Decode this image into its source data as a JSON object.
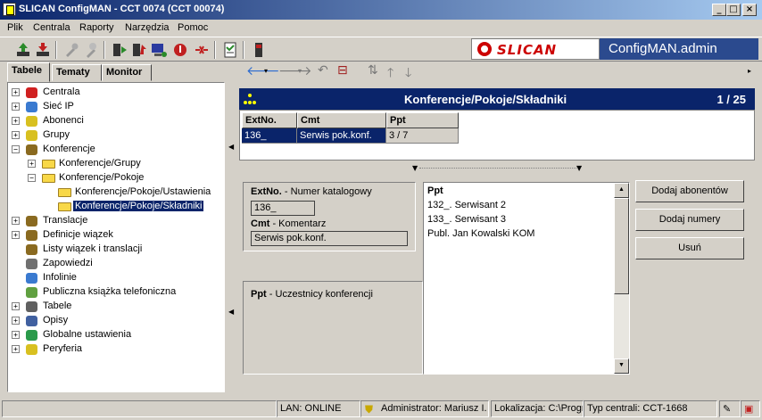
{
  "window": {
    "title": "SLICAN ConfigMAN - CCT 0074 (CCT 00074)",
    "min": "_",
    "max": "□",
    "close": "×"
  },
  "menu": [
    "Plik",
    "Centrala",
    "Raporty",
    "Narzędzia",
    "Pomoc"
  ],
  "brand": {
    "logo_text": "SLICAN",
    "product": "ConfigMAN.admin"
  },
  "left_tabs": [
    "Tabele",
    "Tematy",
    "Monitor"
  ],
  "tree": [
    {
      "label": "Centrala",
      "exp": "+",
      "icon": "red"
    },
    {
      "label": "Sieć IP",
      "exp": "+",
      "icon": "blue"
    },
    {
      "label": "Abonenci",
      "exp": "+",
      "icon": "yellow"
    },
    {
      "label": "Grupy",
      "exp": "+",
      "icon": "yellow"
    },
    {
      "label": "Konferencje",
      "exp": "−",
      "icon": "net"
    },
    {
      "label": "Konferencje/Grupy",
      "exp": "+",
      "icon": "folder"
    },
    {
      "label": "Konferencje/Pokoje",
      "exp": "−",
      "icon": "folder"
    },
    {
      "label": "Konferencje/Pokoje/Ustawienia",
      "exp": "",
      "icon": "folder"
    },
    {
      "label": "Konferencje/Pokoje/Składniki",
      "exp": "",
      "icon": "folder",
      "selected": true
    },
    {
      "label": "Translacje",
      "exp": "+",
      "icon": "net"
    },
    {
      "label": "Definicje wiązek",
      "exp": "+",
      "icon": "net"
    },
    {
      "label": "Listy wiązek i translacji",
      "exp": "",
      "icon": "net"
    },
    {
      "label": "Zapowiedzi",
      "exp": "",
      "icon": "spk"
    },
    {
      "label": "Infolinie",
      "exp": "",
      "icon": "blue"
    },
    {
      "label": "Publiczna książka telefoniczna",
      "exp": "",
      "icon": "book"
    },
    {
      "label": "Tabele",
      "exp": "+",
      "icon": "table"
    },
    {
      "label": "Opisy",
      "exp": "+",
      "icon": "abc"
    },
    {
      "label": "Globalne ustawienia",
      "exp": "+",
      "icon": "globe"
    },
    {
      "label": "Peryferia",
      "exp": "+",
      "icon": "yellow"
    }
  ],
  "table_header": {
    "title": "Konferencje/Pokoje/Składniki",
    "count": "1 / 25"
  },
  "grid": {
    "columns": [
      "ExtNo.",
      "Cmt",
      "Ppt"
    ],
    "row": [
      "136_",
      "Serwis pok.konf.",
      "3 / 7"
    ]
  },
  "form": {
    "extno_label": "ExtNo.",
    "extno_desc": " - Numer katalogowy",
    "extno_value": "136_",
    "cmt_label": "Cmt",
    "cmt_desc": " - Komentarz",
    "cmt_value": "Serwis pok.konf.",
    "ppt_label": "Ppt",
    "ppt_desc": " - Uczestnicy konferencji"
  },
  "ppt_list": {
    "header": "Ppt",
    "items": [
      "132_. Serwisant 2",
      "133_. Serwisant 3",
      "Publ. Jan Kowalski KOM"
    ]
  },
  "buttons": {
    "add_subscribers": "Dodaj abonentów",
    "add_numbers": "Dodaj numery",
    "remove": "Usuń"
  },
  "status": {
    "lan": "LAN: ONLINE",
    "user": "Administrator: Mariusz I.",
    "location": "Lokalizacja: C:\\Progr",
    "type": "Typ centrali: CCT-1668"
  },
  "colors": {
    "selection": "#0a246a",
    "brand_bg": "#2b4a8e",
    "logo_red": "#cc0000"
  }
}
